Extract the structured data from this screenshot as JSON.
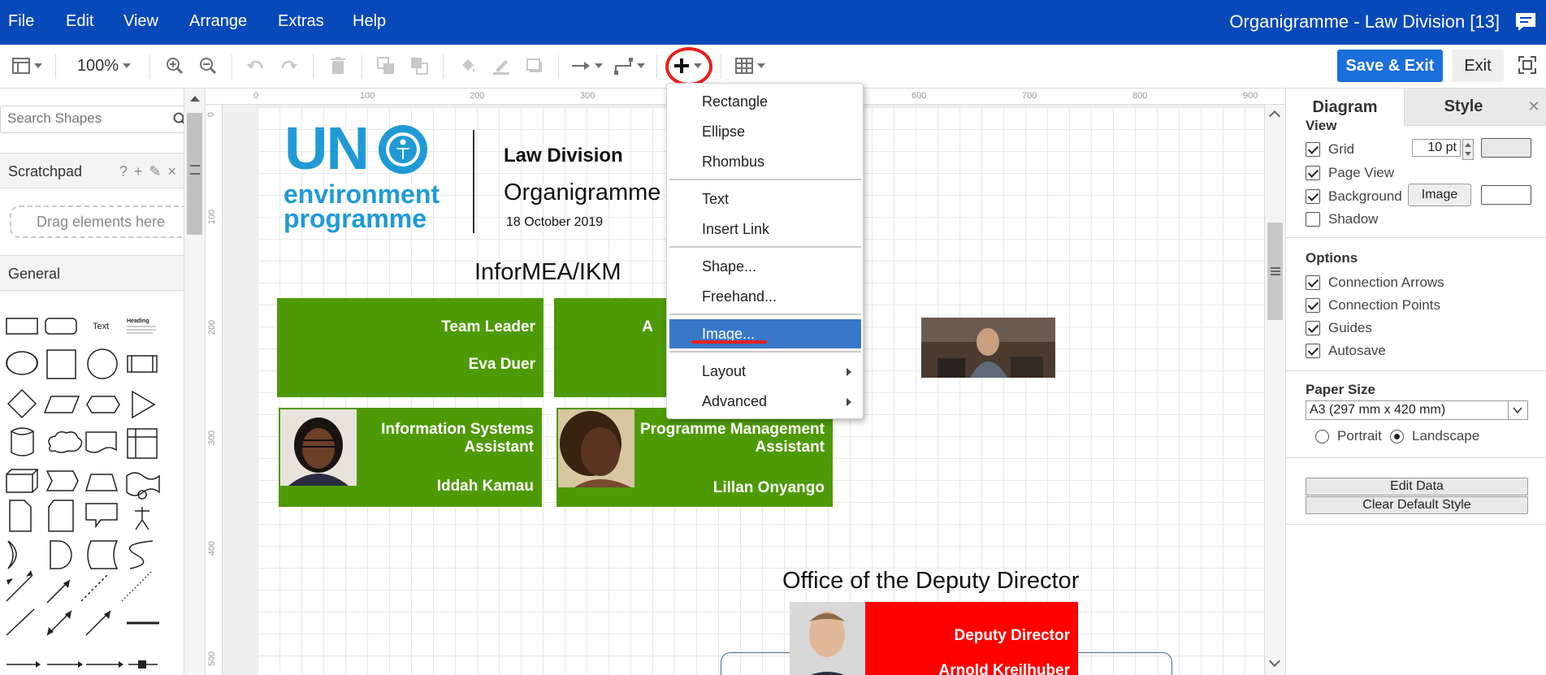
{
  "menubar": {
    "items": [
      "File",
      "Edit",
      "View",
      "Arrange",
      "Extras",
      "Help"
    ],
    "title": "Organigramme - Law Division [13]"
  },
  "toolbar": {
    "zoom": "100%",
    "save_exit_label": "Save & Exit",
    "exit_label": "Exit",
    "icons": [
      "view-icon",
      "zoom-in-icon",
      "zoom-out-icon",
      "undo-icon",
      "redo-icon",
      "delete-icon",
      "to-front-icon",
      "to-back-icon",
      "fill-color-icon",
      "line-color-icon",
      "shadow-icon",
      "connection-icon",
      "waypoints-icon",
      "insert-icon",
      "table-icon"
    ]
  },
  "sidebar": {
    "search_placeholder": "Search Shapes",
    "scratchpad_label": "Scratchpad",
    "scratchpad_icons": [
      "?",
      "+",
      "✎",
      "×"
    ],
    "drag_hint": "Drag elements here",
    "general_label": "General",
    "shape_text_label": "Text",
    "shape_heading_label": "Heading"
  },
  "ruler": {
    "top_labels": [
      "0",
      "100",
      "200",
      "300",
      "600",
      "700",
      "800",
      "900"
    ],
    "left_labels": [
      "0",
      "100",
      "200",
      "300",
      "400",
      "500"
    ]
  },
  "diagram": {
    "logo_un": "UN",
    "logo_line1": "environment",
    "logo_line2": "programme",
    "heading": "Law Division",
    "subheading": "Organigramme",
    "date": "18 October 2019",
    "section1": "InforMEA/IKM",
    "box1_role": "Team Leader",
    "box1_name": "Eva Duer",
    "box2_partial": "A",
    "box3_role": "Information Systems Assistant",
    "box3_name": "Iddah Kamau",
    "box4_role": "Programme Management Assistant",
    "box4_name": "Lillan Onyango",
    "section2": "Office of the Deputy Director",
    "box5_role": "Deputy Director",
    "box5_name": "Arnold Kreilhuber"
  },
  "dropdown": {
    "items": [
      "Rectangle",
      "Ellipse",
      "Rhombus",
      "Text",
      "Insert Link",
      "Shape...",
      "Freehand...",
      "Image...",
      "Layout",
      "Advanced"
    ],
    "selected": "Image..."
  },
  "panel": {
    "tab_diagram": "Diagram",
    "tab_style": "Style",
    "view_header": "View",
    "grid_label": "Grid",
    "grid_value": "10 pt",
    "page_view_label": "Page View",
    "background_label": "Background",
    "image_button": "Image",
    "shadow_label": "Shadow",
    "options_header": "Options",
    "connection_arrows": "Connection Arrows",
    "connection_points": "Connection Points",
    "guides": "Guides",
    "autosave": "Autosave",
    "paper_size_header": "Paper Size",
    "paper_size_value": "A3 (297 mm x 420 mm)",
    "portrait": "Portrait",
    "landscape": "Landscape",
    "edit_data": "Edit Data",
    "clear_default_style": "Clear Default Style"
  },
  "colors": {
    "menubar": "#0849b9",
    "accent_button": "#1a6fdc",
    "green_box": "#4e9a06",
    "red_box": "#ff0000",
    "un_blue": "#1f9ad6",
    "selected_item": "#3878c7",
    "annotation_red": "#e8201c"
  }
}
